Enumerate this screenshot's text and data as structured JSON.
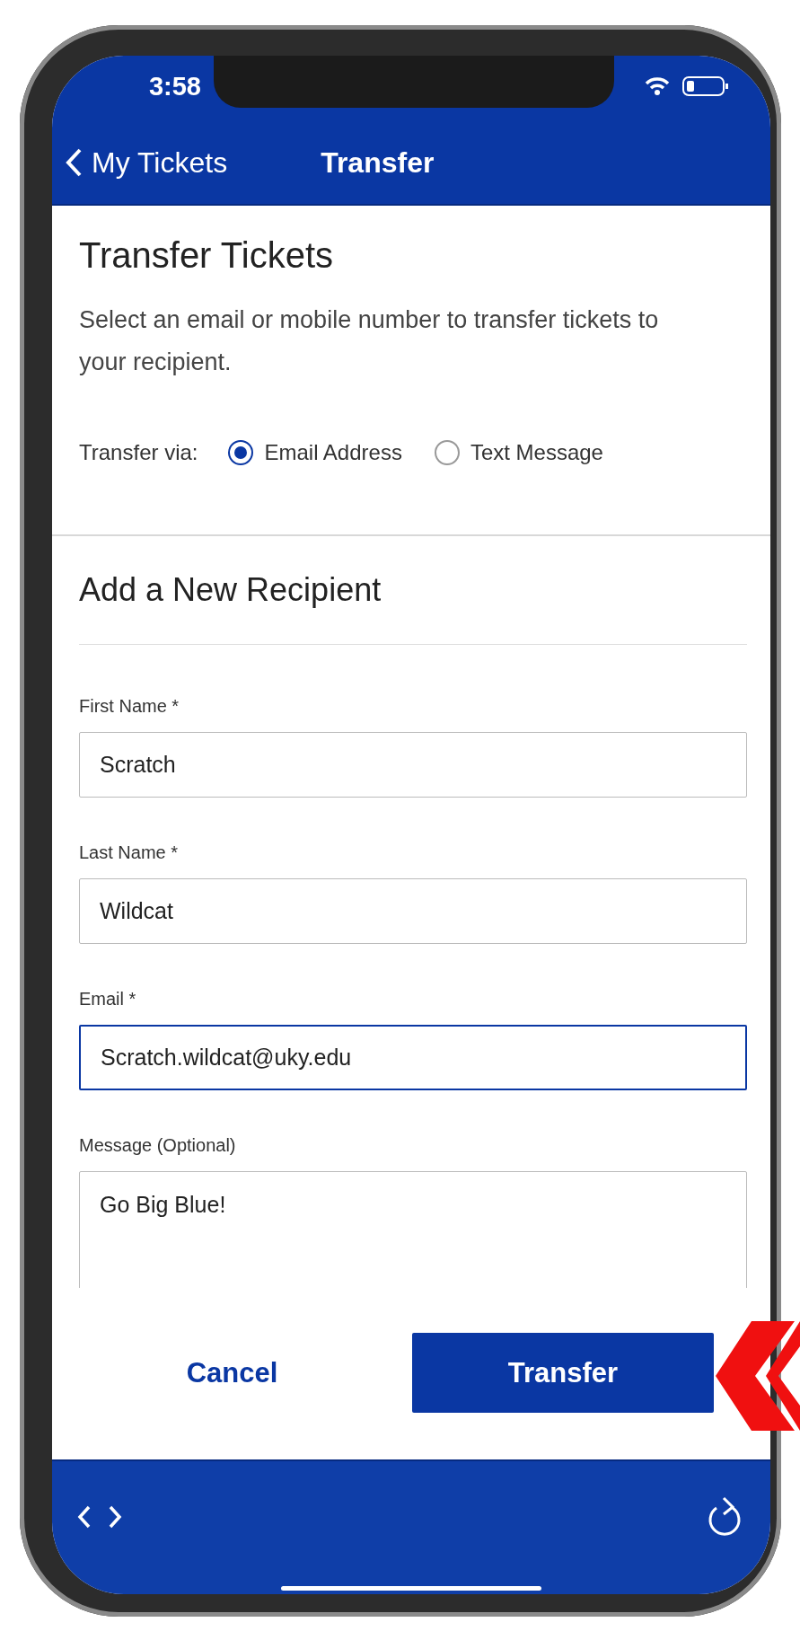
{
  "status_bar": {
    "time": "3:58"
  },
  "nav_bar": {
    "back_label": "My Tickets",
    "title": "Transfer"
  },
  "heading": "Transfer Tickets",
  "description": "Select an email or mobile number to transfer tickets to your recipient.",
  "transfer_via": {
    "label": "Transfer via:",
    "options": [
      {
        "label": "Email Address",
        "selected": true
      },
      {
        "label": "Text Message",
        "selected": false
      }
    ]
  },
  "recipient_section": {
    "title": "Add a New Recipient",
    "fields": [
      {
        "kind": "input",
        "label": "First Name *",
        "value": "Scratch",
        "focused": false
      },
      {
        "kind": "input",
        "label": "Last Name *",
        "value": "Wildcat",
        "focused": false
      },
      {
        "kind": "input",
        "label": "Email *",
        "value": "Scratch.wildcat@uky.edu",
        "focused": true
      },
      {
        "kind": "textarea",
        "label": "Message (Optional)",
        "value": "Go Big Blue!",
        "focused": false
      }
    ]
  },
  "actions": {
    "cancel": "Cancel",
    "confirm": "Transfer"
  }
}
